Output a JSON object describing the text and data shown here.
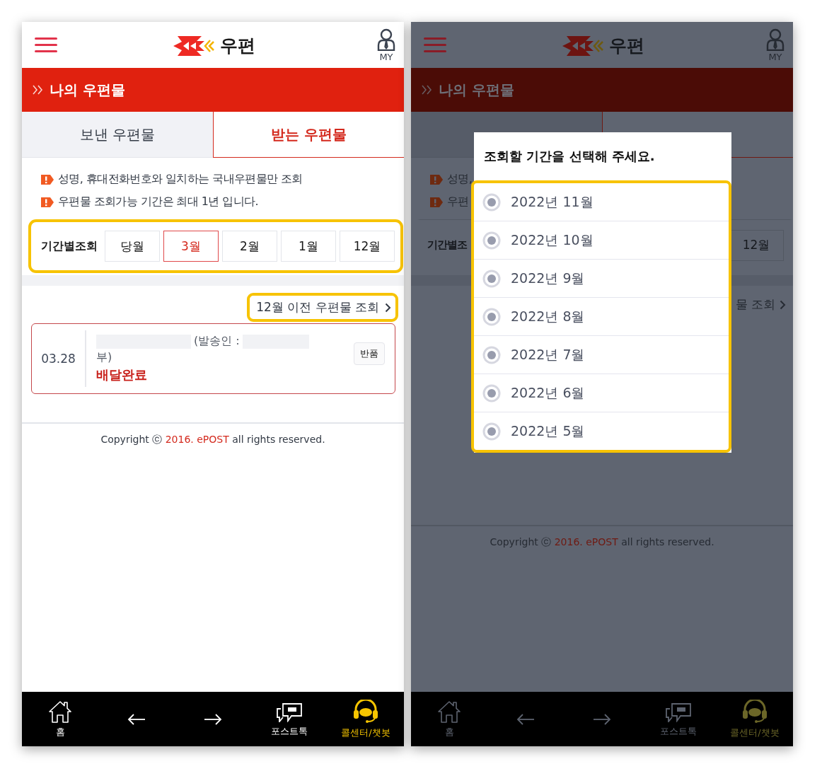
{
  "left_screen": {
    "header": {
      "logo_text": "우편",
      "my_label": "MY"
    },
    "banner": {
      "title": "나의 우편물"
    },
    "tabs": [
      {
        "label": "보낸 우편물",
        "selected": false
      },
      {
        "label": "받는 우편물",
        "selected": true
      }
    ],
    "notices": [
      "성명, 휴대전화번호와 일치하는 국내우편물만 조회",
      "우편물 조회가능 기간은 최대 1년 입니다."
    ],
    "period": {
      "label": "기간별조회",
      "options": [
        {
          "label": "당월",
          "selected": false
        },
        {
          "label": "3월",
          "selected": true
        },
        {
          "label": "2월",
          "selected": false
        },
        {
          "label": "1월",
          "selected": false
        },
        {
          "label": "12월",
          "selected": false
        }
      ]
    },
    "archive_link": "12월 이전 우편물 조회",
    "items": [
      {
        "date": "03.28",
        "sender_label": "(발송인 :",
        "sender_end": "부)",
        "status": "배달완료",
        "action": "반품"
      }
    ],
    "copyright": {
      "prefix": "Copyright ⓒ",
      "highlight": "2016. ePOST",
      "suffix": "all rights reserved."
    },
    "nav": [
      {
        "kind": "home",
        "label": "홈"
      },
      {
        "kind": "back"
      },
      {
        "kind": "forward"
      },
      {
        "kind": "chat",
        "label": "포스트톡"
      },
      {
        "kind": "support",
        "label": "콜센터/챗봇"
      }
    ]
  },
  "right_screen": {
    "header": {
      "logo_text": "우편",
      "my_label": "MY"
    },
    "banner": {
      "title": "나의 우편물"
    },
    "tabs": [
      {
        "selected": false
      },
      {
        "selected": true
      }
    ],
    "notices": [
      "성명,",
      "우편"
    ],
    "period": {
      "label": "기간별조",
      "options": [
        {
          "label": "12월",
          "selected": false
        }
      ]
    },
    "archive_link": "물 조회",
    "copyright": {
      "prefix": "Copyright ⓒ",
      "highlight": "2016. ePOST",
      "suffix": "all rights reserved."
    },
    "nav": [
      {
        "kind": "home",
        "label": "홈"
      },
      {
        "kind": "back"
      },
      {
        "kind": "forward"
      },
      {
        "kind": "chat",
        "label": "포스트톡"
      },
      {
        "kind": "support",
        "label": "콜센터/챗봇"
      }
    ],
    "dialog": {
      "title": "조회할 기간을 선택해 주세요.",
      "options": [
        "2022년 11월",
        "2022년 10월",
        "2022년 9월",
        "2022년 8월",
        "2022년 7월",
        "2022년 6월",
        "2022년 5월"
      ]
    }
  }
}
